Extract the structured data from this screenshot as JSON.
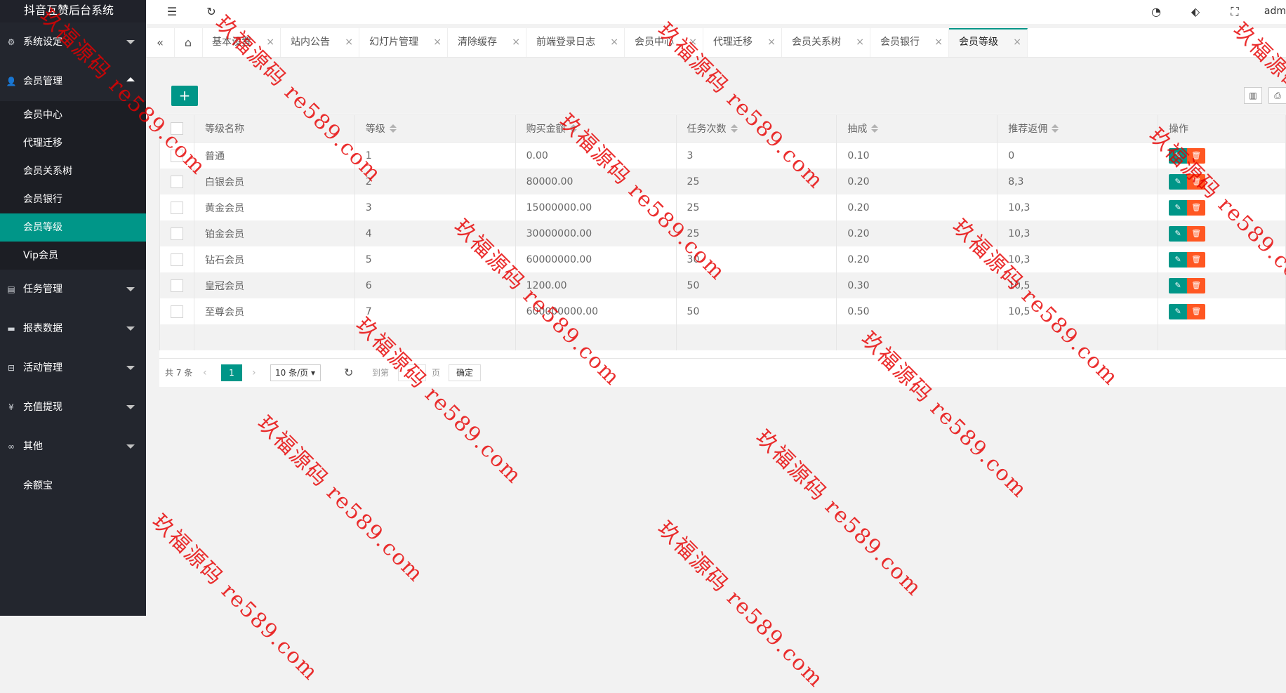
{
  "app_title": "抖音互赞后台系统",
  "sidebar": {
    "menu": [
      {
        "label": "系统设定",
        "icon": "gear-icon"
      },
      {
        "label": "会员管理",
        "icon": "user-icon"
      }
    ],
    "submenu": [
      {
        "label": "会员中心"
      },
      {
        "label": "代理迁移"
      },
      {
        "label": "会员关系树"
      },
      {
        "label": "会员银行"
      },
      {
        "label": "会员等级",
        "active": true
      },
      {
        "label": "Vip会员"
      }
    ],
    "menu2": [
      {
        "label": "任务管理",
        "icon": "list-icon"
      },
      {
        "label": "报表数据",
        "icon": "chart-icon"
      },
      {
        "label": "活动管理",
        "icon": "activity-icon"
      },
      {
        "label": "充值提现",
        "icon": "yen-icon"
      },
      {
        "label": "其他",
        "icon": "infinity-icon"
      },
      {
        "label": "余额宝",
        "icon": ""
      }
    ]
  },
  "header": {
    "admin": "adm"
  },
  "tabs": [
    {
      "label": "基本设置"
    },
    {
      "label": "站内公告"
    },
    {
      "label": "幻灯片管理"
    },
    {
      "label": "清除缓存"
    },
    {
      "label": "前端登录日志"
    },
    {
      "label": "会员中心"
    },
    {
      "label": "代理迁移"
    },
    {
      "label": "会员关系树"
    },
    {
      "label": "会员银行"
    },
    {
      "label": "会员等级",
      "active": true
    }
  ],
  "toolbar": {
    "add_label": "+"
  },
  "table": {
    "columns": [
      "等级名称",
      "等级",
      "购买金额",
      "任务次数",
      "抽成",
      "推荐返佣",
      "操作"
    ],
    "rows": [
      [
        "普通",
        "1",
        "0.00",
        "3",
        "0.10",
        "0"
      ],
      [
        "白银会员",
        "2",
        "80000.00",
        "25",
        "0.20",
        "8,3"
      ],
      [
        "黄金会员",
        "3",
        "15000000.00",
        "25",
        "0.20",
        "10,3"
      ],
      [
        "铂金会员",
        "4",
        "30000000.00",
        "25",
        "0.20",
        "10,3"
      ],
      [
        "钻石会员",
        "5",
        "60000000.00",
        "30",
        "0.20",
        "10,3"
      ],
      [
        "皇冠会员",
        "6",
        "1200.00",
        "50",
        "0.30",
        "10,5"
      ],
      [
        "至尊会员",
        "7",
        "600000000.00",
        "50",
        "0.50",
        "10,5"
      ]
    ]
  },
  "pager": {
    "total": "共 7 条",
    "current_page": "1",
    "page_size": "10 条/页",
    "goto_prefix": "到第",
    "goto_suffix": "页",
    "confirm": "确定"
  },
  "watermark": "玖福源码 re589.com"
}
